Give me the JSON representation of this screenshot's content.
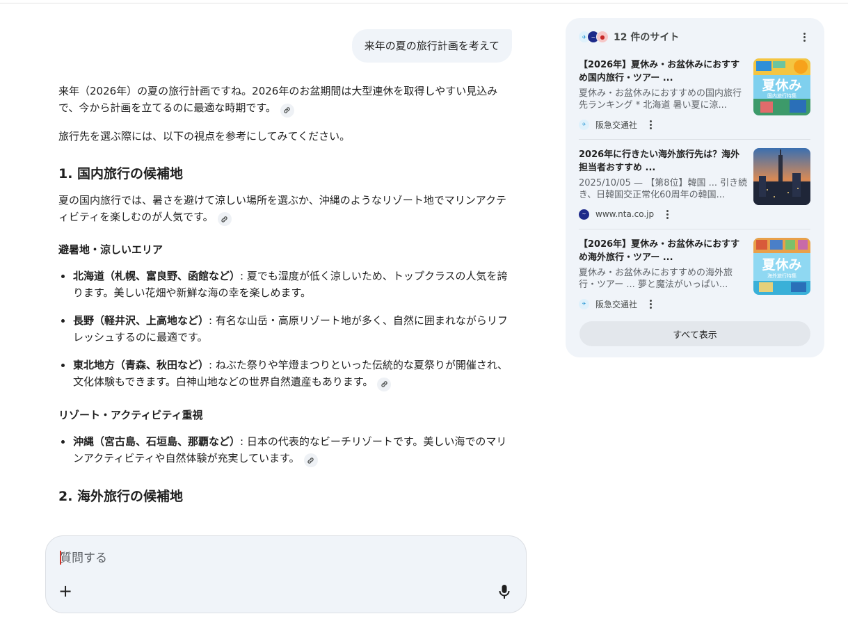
{
  "chat": {
    "user_message": "来年の夏の旅行計画を考えて",
    "intro_p1": "来年（2026年）の夏の旅行計画ですね。2026年のお盆期間は大型連休を取得しやすい見込みで、今から計画を立てるのに最適な時期です。",
    "intro_p2": "旅行先を選ぶ際には、以下の視点を参考にしてみてください。",
    "section1": {
      "heading": "1. 国内旅行の候補地",
      "lead": "夏の国内旅行では、暑さを避けて涼しい場所を選ぶか、沖縄のようなリゾート地でマリンアクティビティを楽しむのが人気です。",
      "sub1_heading": "避暑地・涼しいエリア",
      "sub1_items": [
        {
          "name": "北海道（札幌、富良野、函館など）",
          "desc": ": 夏でも湿度が低く涼しいため、トップクラスの人気を誇ります。美しい花畑や新鮮な海の幸を楽しめます。"
        },
        {
          "name": "長野（軽井沢、上高地など）",
          "desc": ": 有名な山岳・高原リゾート地が多く、自然に囲まれながらリフレッシュするのに最適です。"
        },
        {
          "name": "東北地方（青森、秋田など）",
          "desc": ": ねぶた祭りや竿燈まつりといった伝統的な夏祭りが開催され、文化体験もできます。白神山地などの世界自然遺産もあります。"
        }
      ],
      "sub2_heading": "リゾート・アクティビティ重視",
      "sub2_items": [
        {
          "name": "沖縄（宮古島、石垣島、那覇など）",
          "desc": ": 日本の代表的なビーチリゾートです。美しい海でのマリンアクティビティや自然体験が充実しています。"
        }
      ]
    },
    "section2": {
      "heading": "2. 海外旅行の候補地"
    }
  },
  "input": {
    "placeholder": "質問する",
    "value": ""
  },
  "sources": {
    "count_label": "12 件のサイト",
    "cards": [
      {
        "title": "【2026年】夏休み・お盆休みにおすすめ国内旅行・ツアー ...",
        "snippet": "夏休み・お盆休みにおすすめの国内旅行先ランキング * 北海道 暑い夏に涼...",
        "site": "阪急交通社",
        "thumb_text": "夏休み",
        "thumb_sub": "国内旅行特集"
      },
      {
        "title": "2026年に行きたい海外旅行先は？海外担当者おすすめ ...",
        "snippet": "2025/10/05 — 【第8位】韓国 ... 引き続き、日韓国交正常化60周年の韓国...",
        "site": "www.nta.co.jp"
      },
      {
        "title": "【2026年】夏休み・お盆休みにおすすめ海外旅行・ツアー ...",
        "snippet": "夏休み・お盆休みにおすすめの海外旅行・ツアー ... 夢と魔法がいっぱい...",
        "site": "阪急交通社",
        "thumb_text": "夏休み",
        "thumb_sub": "海外旅行特集"
      }
    ],
    "show_all_label": "すべて表示"
  },
  "colors": {
    "panel_bg": "#f0f4f9",
    "text": "#1f1f1f",
    "muted": "#5f6368"
  }
}
